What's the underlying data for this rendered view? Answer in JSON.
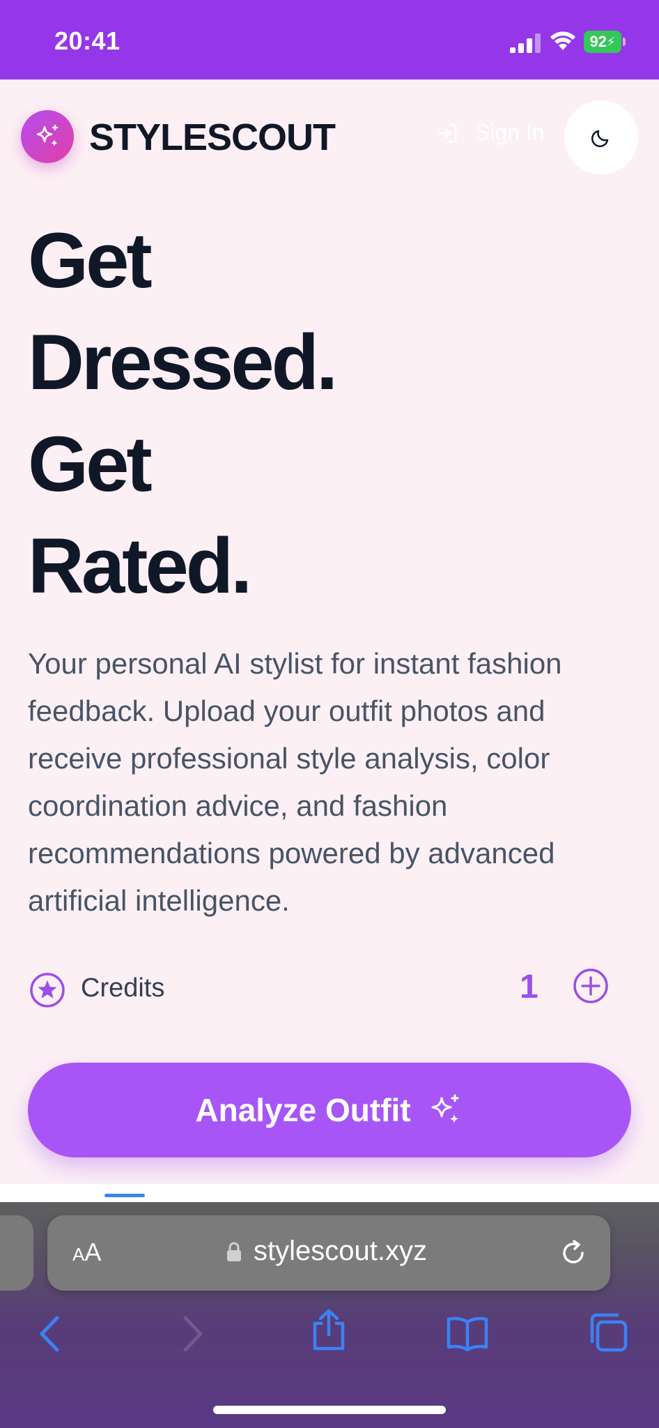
{
  "status_bar": {
    "time": "20:41",
    "battery": "92"
  },
  "header": {
    "brand": "STYLESCOUT",
    "sign_in_label": "Sign In",
    "logo_icon": "sparkles-icon",
    "theme_icon": "moon-icon"
  },
  "hero": {
    "lines": [
      "Get",
      "Dressed.",
      "Get",
      "Rated."
    ],
    "description": "Your personal AI stylist for instant fashion feedback. Upload your outfit photos and receive professional style analysis, color coordination advice, and fashion recommendations powered by advanced artificial intelligence."
  },
  "credits": {
    "label": "Credits",
    "value": "1"
  },
  "cta": {
    "label": "Analyze Outfit"
  },
  "browser": {
    "text_size_small": "A",
    "text_size_large": "A",
    "url": "stylescout.xyz"
  },
  "colors": {
    "status_bar": "#9536e8",
    "accent": "#a855f7",
    "background": "#fcf0f5",
    "heading": "#101828"
  }
}
